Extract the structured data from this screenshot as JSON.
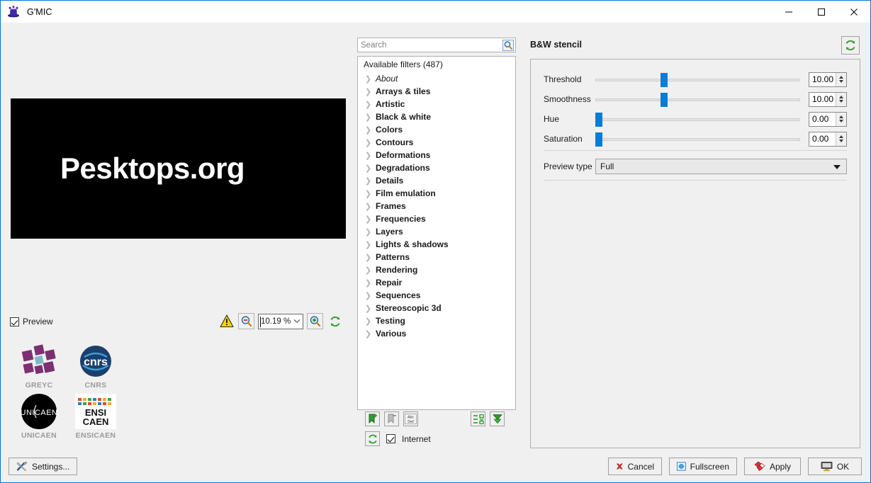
{
  "window": {
    "title": "G'MIC",
    "logo_icon": "gmic-hat-icon",
    "minimize_icon": "minimize-icon",
    "maximize_icon": "maximize-icon",
    "close_icon": "close-icon"
  },
  "preview": {
    "image_text": "Pesktops.org",
    "checkbox_label": "Preview",
    "checkbox_checked": true,
    "warning_icon": "warning-triangle-icon",
    "zoom_out_icon": "zoom-out-icon",
    "zoom_in_icon": "zoom-in-icon",
    "refresh_icon": "refresh-icon",
    "zoom_value": "10.19 %",
    "zoom_dropdown_icon": "chevron-down-icon"
  },
  "logos": [
    {
      "name": "GREYC",
      "caption": "GREYC"
    },
    {
      "name": "CNRS",
      "caption": "CNRS"
    },
    {
      "name": "UNICAEN",
      "caption": "UNICAEN"
    },
    {
      "name": "ENSICAEN",
      "caption": "ENSICAEN"
    }
  ],
  "search": {
    "placeholder": "Search",
    "value": "",
    "icon": "search-icon"
  },
  "filters": {
    "header": "Available filters (487)",
    "items": [
      {
        "label": "About",
        "style": "italic"
      },
      {
        "label": "Arrays & tiles",
        "style": "bold"
      },
      {
        "label": "Artistic",
        "style": "bold"
      },
      {
        "label": "Black & white",
        "style": "bold"
      },
      {
        "label": "Colors",
        "style": "bold"
      },
      {
        "label": "Contours",
        "style": "bold"
      },
      {
        "label": "Deformations",
        "style": "bold"
      },
      {
        "label": "Degradations",
        "style": "bold"
      },
      {
        "label": "Details",
        "style": "bold"
      },
      {
        "label": "Film emulation",
        "style": "bold"
      },
      {
        "label": "Frames",
        "style": "bold"
      },
      {
        "label": "Frequencies",
        "style": "bold"
      },
      {
        "label": "Layers",
        "style": "bold"
      },
      {
        "label": "Lights & shadows",
        "style": "bold"
      },
      {
        "label": "Patterns",
        "style": "bold"
      },
      {
        "label": "Rendering",
        "style": "bold"
      },
      {
        "label": "Repair",
        "style": "bold"
      },
      {
        "label": "Sequences",
        "style": "bold"
      },
      {
        "label": "Stereoscopic 3d",
        "style": "bold"
      },
      {
        "label": "Testing",
        "style": "bold"
      },
      {
        "label": "Various",
        "style": "bold"
      }
    ],
    "toolbar": {
      "add_fave_icon": "add-favorite-icon",
      "remove_fave_icon": "remove-favorite-icon",
      "rename_icon": "rename-abc-def-icon",
      "rename_top_text": "Abc",
      "rename_bottom_text": "Def",
      "expand_icon": "filter-list-icon",
      "download_icon": "download-arrow-icon",
      "refresh_icon": "refresh-icon"
    },
    "internet_label": "Internet",
    "internet_checked": true
  },
  "parameters": {
    "title": "B&W stencil",
    "refresh_icon": "refresh-icon",
    "sliders": [
      {
        "label": "Threshold",
        "value": "10.00",
        "percent": 33
      },
      {
        "label": "Smoothness",
        "value": "10.00",
        "percent": 33
      },
      {
        "label": "Hue",
        "value": "0.00",
        "percent": 0
      },
      {
        "label": "Saturation",
        "value": "0.00",
        "percent": 0
      }
    ],
    "preview_type": {
      "label": "Preview type",
      "value": "Full",
      "arrow_icon": "chevron-down-icon"
    }
  },
  "footer": {
    "settings_label": "Settings...",
    "settings_icon": "tools-icon",
    "cancel_label": "Cancel",
    "cancel_icon": "cancel-x-icon",
    "fullscreen_label": "Fullscreen",
    "fullscreen_icon": "fullscreen-icon",
    "apply_label": "Apply",
    "apply_icon": "apply-icon",
    "ok_label": "OK",
    "ok_icon": "monitor-icon"
  },
  "colors": {
    "accent_blue": "#0078d7",
    "slider_blue": "#0b7cd4",
    "window_bg": "#f0f0f0",
    "panel_white": "#ffffff",
    "green_icon": "#3aa93a"
  }
}
